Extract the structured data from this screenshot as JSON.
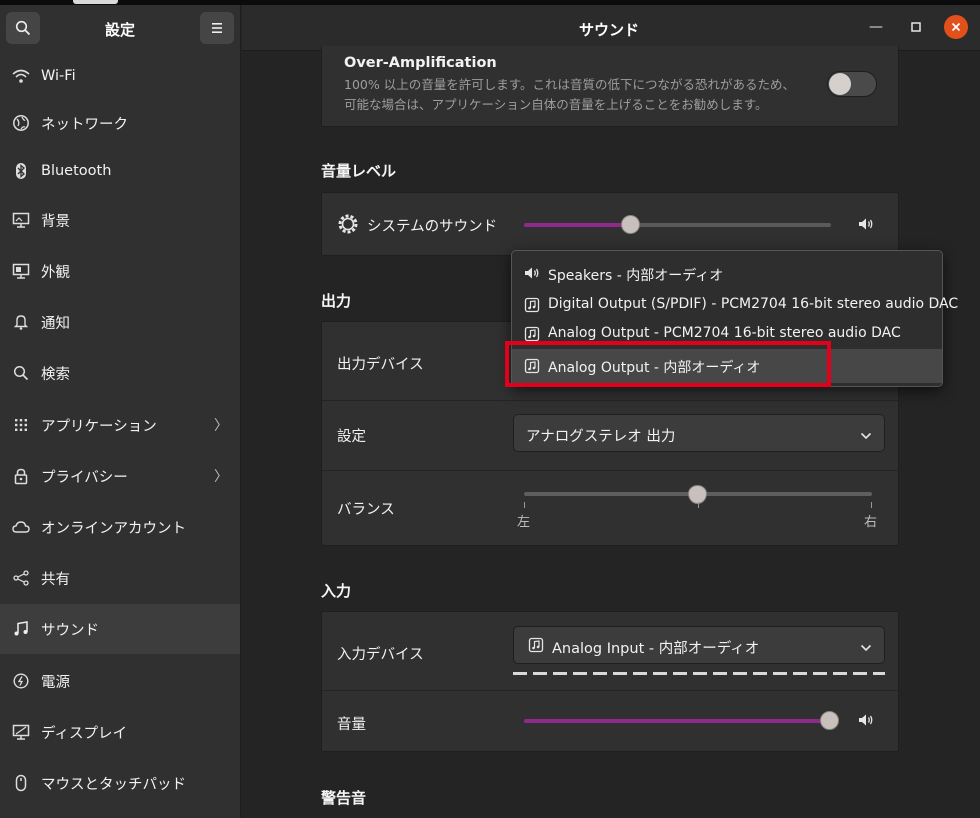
{
  "sidebar": {
    "title": "設定",
    "items": [
      {
        "label": "Wi-Fi",
        "icon": "wifi-icon"
      },
      {
        "label": "ネットワーク",
        "icon": "network-icon"
      },
      {
        "label": "Bluetooth",
        "icon": "bluetooth-icon"
      },
      {
        "label": "背景",
        "icon": "background-icon"
      },
      {
        "label": "外観",
        "icon": "appearance-icon"
      },
      {
        "label": "通知",
        "icon": "bell-icon"
      },
      {
        "label": "検索",
        "icon": "search-icon"
      },
      {
        "label": "アプリケーション",
        "icon": "apps-grid-icon"
      },
      {
        "label": "プライバシー",
        "icon": "lock-icon"
      },
      {
        "label": "オンラインアカウント",
        "icon": "cloud-icon"
      },
      {
        "label": "共有",
        "icon": "share-icon"
      },
      {
        "label": "サウンド",
        "icon": "music-note-icon"
      },
      {
        "label": "電源",
        "icon": "power-icon"
      },
      {
        "label": "ディスプレイ",
        "icon": "display-icon"
      },
      {
        "label": "マウスとタッチパッド",
        "icon": "mouse-icon"
      }
    ]
  },
  "header": {
    "title": "サウンド"
  },
  "over_amplification": {
    "title": "Over-Amplification",
    "line1": "100% 以上の音量を許可します。これは音質の低下につながる恐れがあるため、",
    "line2": "可能な場合は、アプリケーション自体の音量を上げることをお勧めします。",
    "enabled": false
  },
  "volume_levels": {
    "title": "音量レベル",
    "system_sounds_label": "システムのサウンド",
    "level_percent": 35
  },
  "output": {
    "title": "出力",
    "device_label": "出力デバイス",
    "config_label": "設定",
    "config_value": "アナログステレオ 出力",
    "balance_label": "バランス",
    "balance_left": "左",
    "balance_right": "右",
    "balance_percent": 50
  },
  "input": {
    "title": "入力",
    "device_label": "入力デバイス",
    "device_value": "Analog Input - 内部オーディオ",
    "volume_label": "音量",
    "volume_percent": 100
  },
  "alert_sounds": {
    "title": "警告音"
  },
  "output_menu": {
    "items": [
      {
        "label": "Speakers - 内部オーディオ",
        "icon": "speaker-icon"
      },
      {
        "label": "Digital Output (S/PDIF) - PCM2704 16-bit stereo audio DAC",
        "icon": "audio-card-icon"
      },
      {
        "label": "Analog Output - PCM2704 16-bit stereo audio DAC",
        "icon": "audio-card-icon"
      },
      {
        "label": "Analog Output - 内部オーディオ",
        "icon": "audio-card-icon"
      }
    ],
    "selected_index": 3
  },
  "colors": {
    "accent": "#8e2a8a",
    "highlight": "#e3001b",
    "close": "#e2511c"
  }
}
